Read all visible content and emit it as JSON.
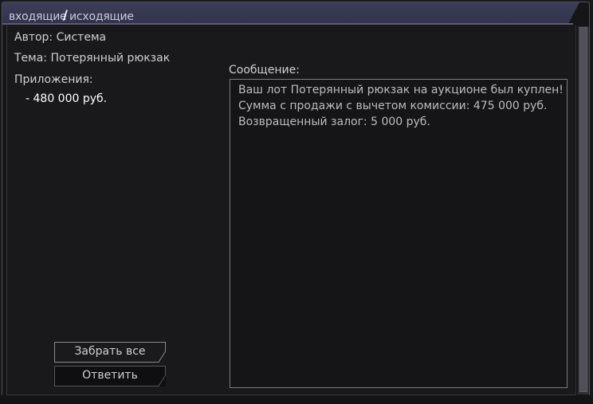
{
  "tabs": {
    "inbox": "входящие",
    "separator": "/",
    "outbox": "исходящие"
  },
  "mail": {
    "author": "Автор: Система",
    "subject": "Тема: Потерянный рюкзак",
    "attachments_label": "Приложения:",
    "attachments": [
      "- 480 000 руб."
    ]
  },
  "message": {
    "label": "Сообщение:",
    "lines": [
      "Ваш лот Потерянный рюкзак на аукционе был куплен!",
      "Сумма с продажи с вычетом комиссии: 475 000 руб.",
      "Возвращенный залог: 5 000 руб."
    ]
  },
  "buttons": {
    "collect_all": "Забрать все",
    "reply": "Ответить"
  }
}
